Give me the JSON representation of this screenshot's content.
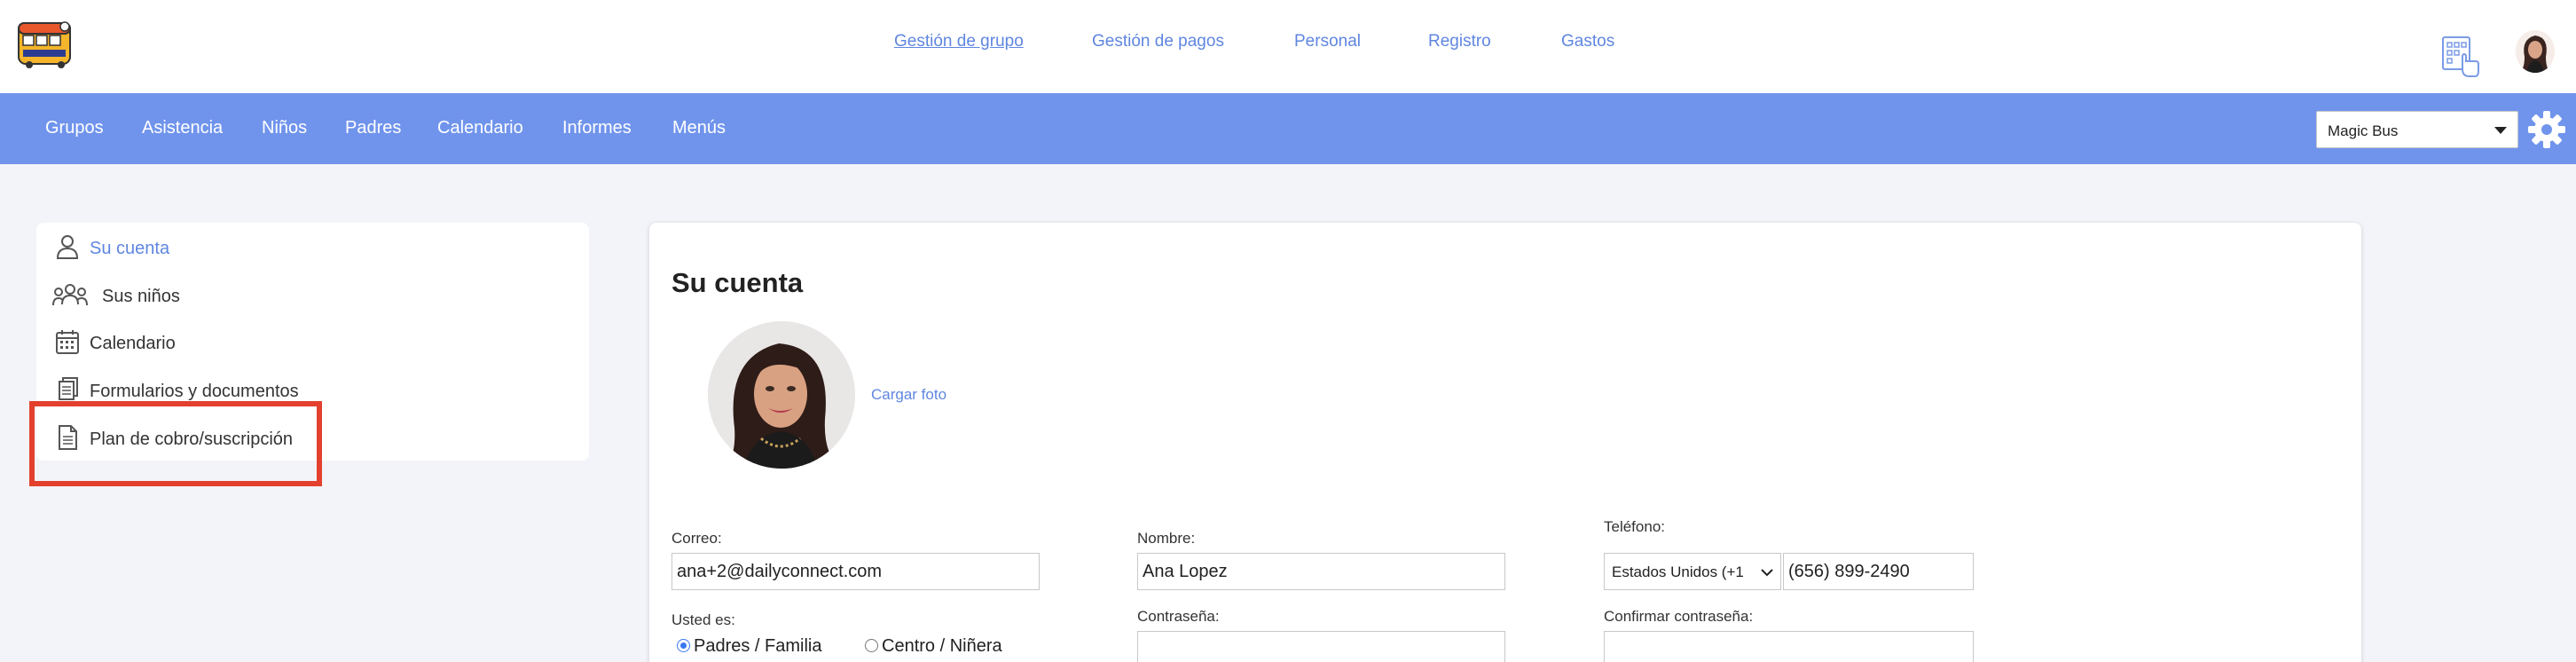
{
  "topnav": {
    "items": [
      {
        "label": "Gestión de grupo",
        "active": true
      },
      {
        "label": "Gestión de pagos",
        "active": false
      },
      {
        "label": "Personal",
        "active": false
      },
      {
        "label": "Registro",
        "active": false
      },
      {
        "label": "Gastos",
        "active": false
      }
    ]
  },
  "mainnav": {
    "items": [
      "Grupos",
      "Asistencia",
      "Niños",
      "Padres",
      "Calendario",
      "Informes",
      "Menús"
    ],
    "school_select": "Magic Bus"
  },
  "sidebar": {
    "items": [
      {
        "label": "Su cuenta",
        "icon": "user-icon",
        "active": true
      },
      {
        "label": "Sus niños",
        "icon": "group-icon",
        "active": false
      },
      {
        "label": "Calendario",
        "icon": "calendar-icon",
        "active": false
      },
      {
        "label": "Formularios y documentos",
        "icon": "documents-icon",
        "active": false
      },
      {
        "label": "Plan de cobro/suscripción",
        "icon": "document-icon",
        "active": false
      }
    ]
  },
  "account": {
    "title": "Su cuenta",
    "upload_photo": "Cargar foto",
    "email_label": "Correo:",
    "email_value": "ana+2@dailyconnect.com",
    "name_label": "Nombre:",
    "name_value": "Ana Lopez",
    "phone_label": "Teléfono:",
    "phone_country": "Estados Unidos (+1",
    "phone_value": "(656) 899-2490",
    "role_label": "Usted es:",
    "role_options": [
      "Padres / Familia",
      "Centro / Niñera"
    ],
    "role_selected": "Padres / Familia",
    "password_label": "Contraseña:",
    "password_value": "",
    "confirm_label": "Confirmar contraseña:",
    "confirm_value": ""
  },
  "colors": {
    "accent": "#7094ec",
    "link": "#5f86e0",
    "highlight": "#e3402e"
  }
}
